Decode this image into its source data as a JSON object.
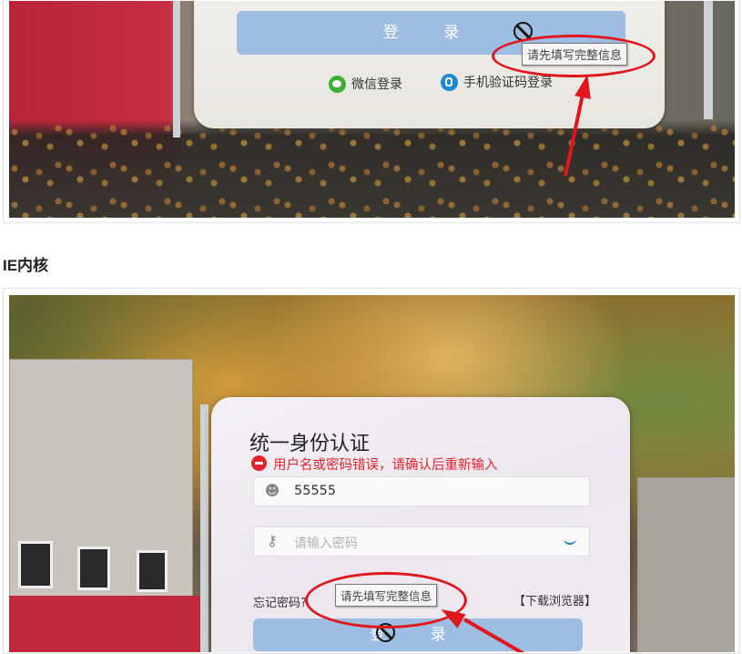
{
  "screenshot1": {
    "login_button_label": "登 录",
    "tooltip": "请先填写完整信息",
    "alt_login": {
      "wechat_label": "微信登录",
      "phone_label": "手机验证码登录"
    }
  },
  "section_heading": "IE内核",
  "screenshot2": {
    "card_title": "统一身份认证",
    "error_message": "用户名或密码错误，请确认后重新输入",
    "username_value": "55555",
    "password_placeholder": "请输入密码",
    "forgot_password": "忘记密码?",
    "tooltip": "请先填写完整信息",
    "download_browser": "【下载浏览器】",
    "login_button_label": "登 录"
  },
  "colors": {
    "annotation_red": "#e0161c",
    "login_button": "#9dbde2",
    "error_red": "#e0232b"
  },
  "icons": [
    "ban-cursor-icon",
    "wechat-icon",
    "phone-icon",
    "user-icon",
    "key-icon",
    "eye-icon",
    "error-icon"
  ]
}
